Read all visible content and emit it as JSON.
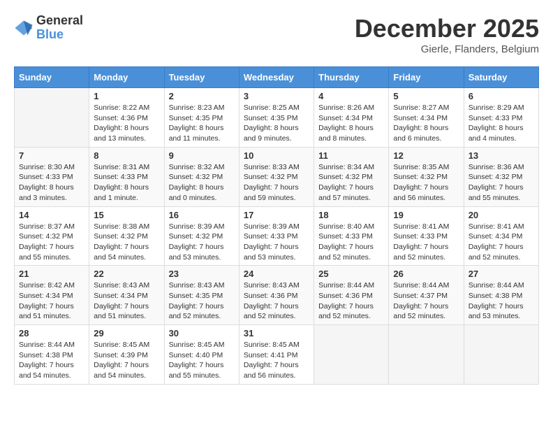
{
  "header": {
    "logo": {
      "general": "General",
      "blue": "Blue"
    },
    "title": "December 2025",
    "location": "Gierle, Flanders, Belgium"
  },
  "days_of_week": [
    "Sunday",
    "Monday",
    "Tuesday",
    "Wednesday",
    "Thursday",
    "Friday",
    "Saturday"
  ],
  "weeks": [
    [
      {
        "day": "",
        "info": ""
      },
      {
        "day": "1",
        "info": "Sunrise: 8:22 AM\nSunset: 4:36 PM\nDaylight: 8 hours\nand 13 minutes."
      },
      {
        "day": "2",
        "info": "Sunrise: 8:23 AM\nSunset: 4:35 PM\nDaylight: 8 hours\nand 11 minutes."
      },
      {
        "day": "3",
        "info": "Sunrise: 8:25 AM\nSunset: 4:35 PM\nDaylight: 8 hours\nand 9 minutes."
      },
      {
        "day": "4",
        "info": "Sunrise: 8:26 AM\nSunset: 4:34 PM\nDaylight: 8 hours\nand 8 minutes."
      },
      {
        "day": "5",
        "info": "Sunrise: 8:27 AM\nSunset: 4:34 PM\nDaylight: 8 hours\nand 6 minutes."
      },
      {
        "day": "6",
        "info": "Sunrise: 8:29 AM\nSunset: 4:33 PM\nDaylight: 8 hours\nand 4 minutes."
      }
    ],
    [
      {
        "day": "7",
        "info": "Sunrise: 8:30 AM\nSunset: 4:33 PM\nDaylight: 8 hours\nand 3 minutes."
      },
      {
        "day": "8",
        "info": "Sunrise: 8:31 AM\nSunset: 4:33 PM\nDaylight: 8 hours\nand 1 minute."
      },
      {
        "day": "9",
        "info": "Sunrise: 8:32 AM\nSunset: 4:32 PM\nDaylight: 8 hours\nand 0 minutes."
      },
      {
        "day": "10",
        "info": "Sunrise: 8:33 AM\nSunset: 4:32 PM\nDaylight: 7 hours\nand 59 minutes."
      },
      {
        "day": "11",
        "info": "Sunrise: 8:34 AM\nSunset: 4:32 PM\nDaylight: 7 hours\nand 57 minutes."
      },
      {
        "day": "12",
        "info": "Sunrise: 8:35 AM\nSunset: 4:32 PM\nDaylight: 7 hours\nand 56 minutes."
      },
      {
        "day": "13",
        "info": "Sunrise: 8:36 AM\nSunset: 4:32 PM\nDaylight: 7 hours\nand 55 minutes."
      }
    ],
    [
      {
        "day": "14",
        "info": "Sunrise: 8:37 AM\nSunset: 4:32 PM\nDaylight: 7 hours\nand 55 minutes."
      },
      {
        "day": "15",
        "info": "Sunrise: 8:38 AM\nSunset: 4:32 PM\nDaylight: 7 hours\nand 54 minutes."
      },
      {
        "day": "16",
        "info": "Sunrise: 8:39 AM\nSunset: 4:32 PM\nDaylight: 7 hours\nand 53 minutes."
      },
      {
        "day": "17",
        "info": "Sunrise: 8:39 AM\nSunset: 4:33 PM\nDaylight: 7 hours\nand 53 minutes."
      },
      {
        "day": "18",
        "info": "Sunrise: 8:40 AM\nSunset: 4:33 PM\nDaylight: 7 hours\nand 52 minutes."
      },
      {
        "day": "19",
        "info": "Sunrise: 8:41 AM\nSunset: 4:33 PM\nDaylight: 7 hours\nand 52 minutes."
      },
      {
        "day": "20",
        "info": "Sunrise: 8:41 AM\nSunset: 4:34 PM\nDaylight: 7 hours\nand 52 minutes."
      }
    ],
    [
      {
        "day": "21",
        "info": "Sunrise: 8:42 AM\nSunset: 4:34 PM\nDaylight: 7 hours\nand 51 minutes."
      },
      {
        "day": "22",
        "info": "Sunrise: 8:43 AM\nSunset: 4:34 PM\nDaylight: 7 hours\nand 51 minutes."
      },
      {
        "day": "23",
        "info": "Sunrise: 8:43 AM\nSunset: 4:35 PM\nDaylight: 7 hours\nand 52 minutes."
      },
      {
        "day": "24",
        "info": "Sunrise: 8:43 AM\nSunset: 4:36 PM\nDaylight: 7 hours\nand 52 minutes."
      },
      {
        "day": "25",
        "info": "Sunrise: 8:44 AM\nSunset: 4:36 PM\nDaylight: 7 hours\nand 52 minutes."
      },
      {
        "day": "26",
        "info": "Sunrise: 8:44 AM\nSunset: 4:37 PM\nDaylight: 7 hours\nand 52 minutes."
      },
      {
        "day": "27",
        "info": "Sunrise: 8:44 AM\nSunset: 4:38 PM\nDaylight: 7 hours\nand 53 minutes."
      }
    ],
    [
      {
        "day": "28",
        "info": "Sunrise: 8:44 AM\nSunset: 4:38 PM\nDaylight: 7 hours\nand 54 minutes."
      },
      {
        "day": "29",
        "info": "Sunrise: 8:45 AM\nSunset: 4:39 PM\nDaylight: 7 hours\nand 54 minutes."
      },
      {
        "day": "30",
        "info": "Sunrise: 8:45 AM\nSunset: 4:40 PM\nDaylight: 7 hours\nand 55 minutes."
      },
      {
        "day": "31",
        "info": "Sunrise: 8:45 AM\nSunset: 4:41 PM\nDaylight: 7 hours\nand 56 minutes."
      },
      {
        "day": "",
        "info": ""
      },
      {
        "day": "",
        "info": ""
      },
      {
        "day": "",
        "info": ""
      }
    ]
  ]
}
